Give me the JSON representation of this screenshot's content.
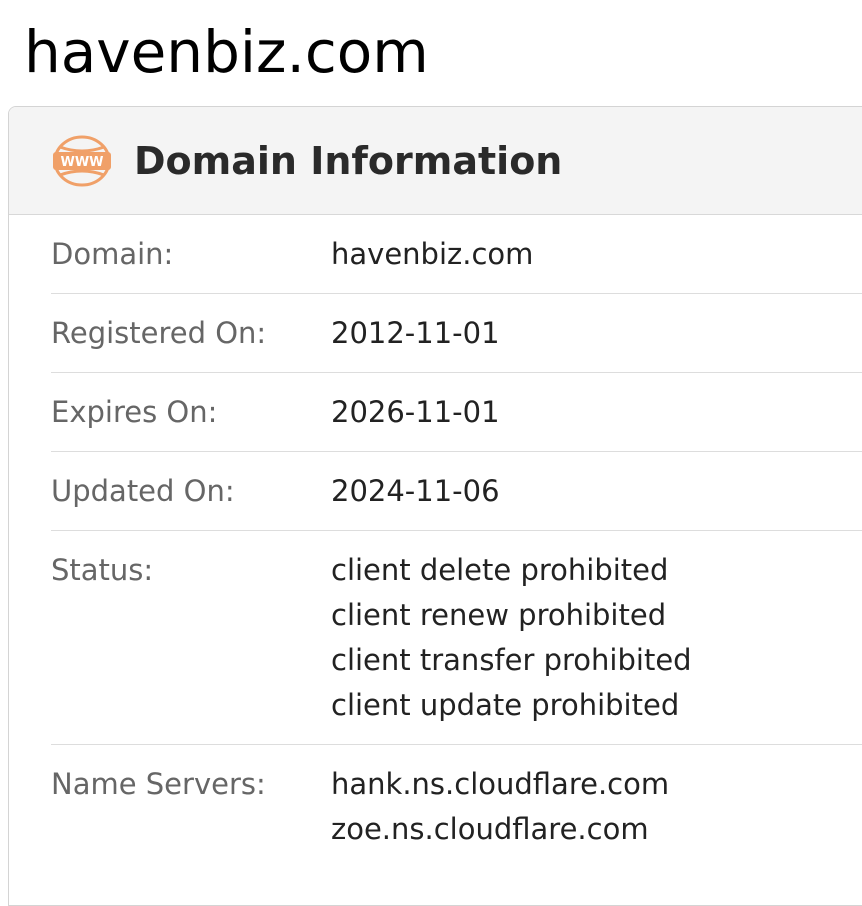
{
  "page": {
    "title": "havenbiz.com"
  },
  "panel": {
    "title": "Domain Information",
    "icon": "www-globe-icon",
    "accent_color": "#f0a068",
    "rows": [
      {
        "label": "Domain:",
        "value": "havenbiz.com"
      },
      {
        "label": "Registered On:",
        "value": "2012-11-01"
      },
      {
        "label": "Expires On:",
        "value": "2026-11-01"
      },
      {
        "label": "Updated On:",
        "value": "2024-11-06"
      }
    ],
    "status": {
      "label": "Status:",
      "values": [
        "client delete prohibited",
        "client renew prohibited",
        "client transfer prohibited",
        "client update prohibited"
      ]
    },
    "name_servers": {
      "label": "Name Servers:",
      "values": [
        "hank.ns.cloudflare.com",
        "zoe.ns.cloudflare.com"
      ]
    }
  }
}
